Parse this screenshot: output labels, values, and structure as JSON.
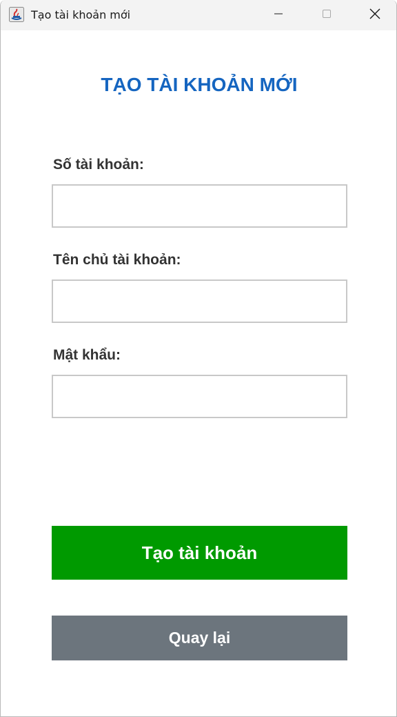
{
  "window": {
    "title": "Tạo tài khoản mới",
    "controls": [
      "minimize-icon",
      "maximize-icon",
      "close-icon"
    ]
  },
  "form": {
    "heading": "TẠO TÀI KHOẢN MỚI",
    "fields": [
      {
        "label": "Số tài khoản:",
        "value": "",
        "placeholder": ""
      },
      {
        "label": "Tên chủ tài khoản:",
        "value": "",
        "placeholder": ""
      },
      {
        "label": "Mật khẩu:",
        "value": "",
        "placeholder": ""
      }
    ],
    "create_label": "Tạo tài khoản",
    "back_label": "Quay lại"
  },
  "colors": {
    "heading": "#1565c0",
    "create_button": "#009a00",
    "back_button": "#6c757d",
    "label_text": "#333333",
    "input_border": "#c8c8c8"
  }
}
